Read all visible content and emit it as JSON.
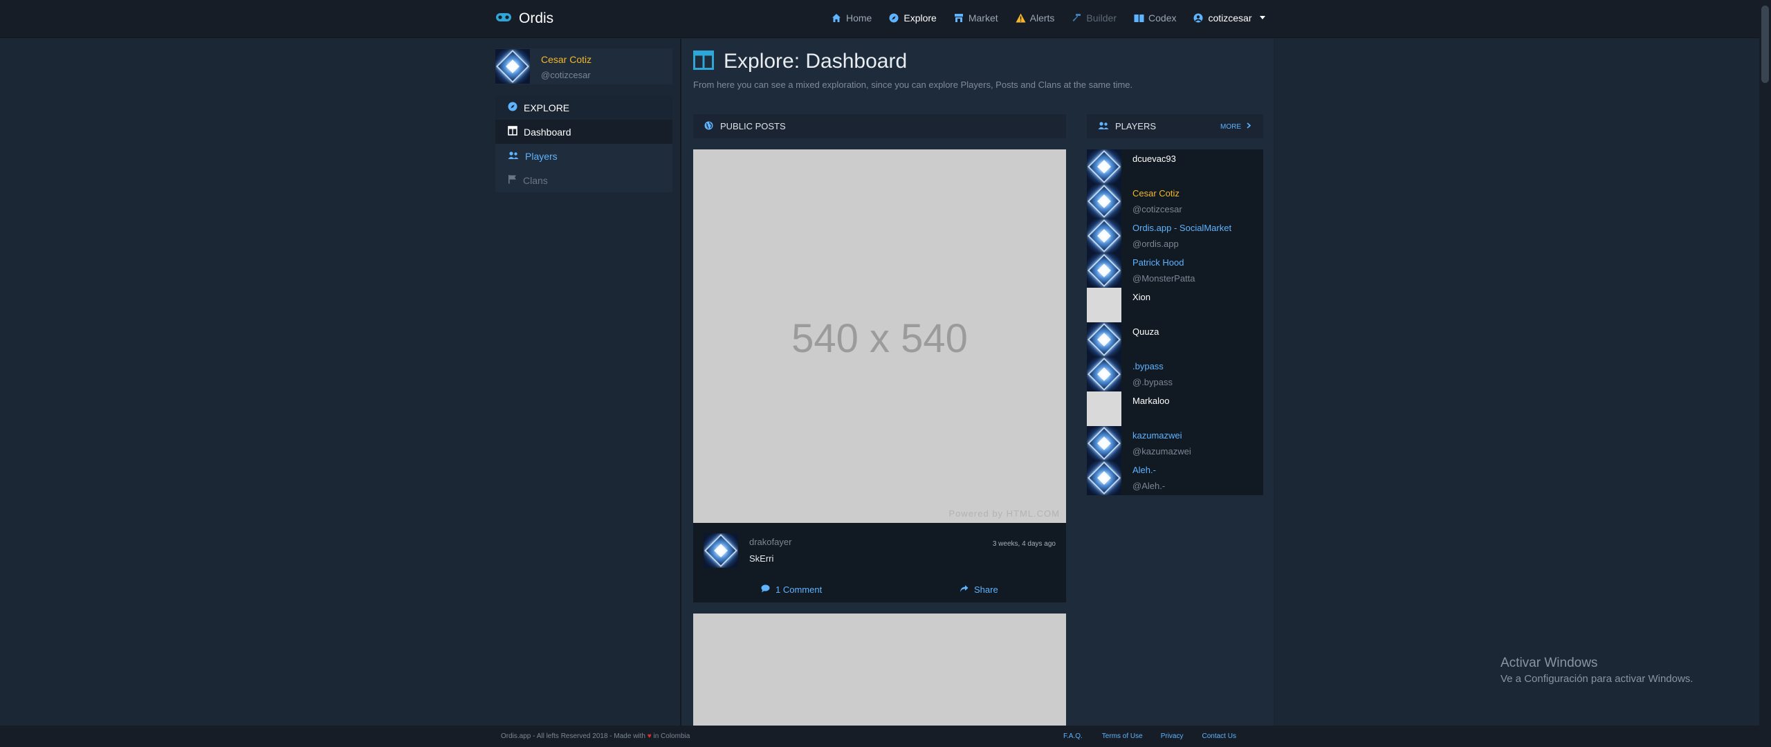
{
  "navbar": {
    "brand": "Ordis",
    "items": [
      {
        "label": "Home",
        "icon": "home-icon",
        "state": "normal"
      },
      {
        "label": "Explore",
        "icon": "compass-icon",
        "state": "active"
      },
      {
        "label": "Market",
        "icon": "market-icon",
        "state": "normal"
      },
      {
        "label": "Alerts",
        "icon": "warning-icon",
        "state": "normal"
      },
      {
        "label": "Builder",
        "icon": "hammer-icon",
        "state": "disabled"
      },
      {
        "label": "Codex",
        "icon": "book-icon",
        "state": "normal"
      }
    ],
    "user": "cotizcesar"
  },
  "profile": {
    "name": "Cesar Cotiz",
    "handle": "@cotizcesar"
  },
  "sidebar": {
    "header": "EXPLORE",
    "items": [
      {
        "label": "Dashboard",
        "icon": "table-icon"
      },
      {
        "label": "Players",
        "icon": "users-icon"
      },
      {
        "label": "Clans",
        "icon": "flag-icon"
      }
    ]
  },
  "page": {
    "title": "Explore: Dashboard",
    "description": "From here you can see a mixed exploration, since you can explore Players, Posts and Clans at the same time."
  },
  "posts": {
    "header": "PUBLIC POSTS",
    "items": [
      {
        "image_text": "540 x 540",
        "image_credit": "Powered by HTML.COM",
        "user": "drakofayer",
        "text": "SkErri",
        "time": "3 weeks, 4 days ago",
        "comments_label": "1 Comment",
        "share_label": "Share"
      }
    ]
  },
  "players": {
    "header": "PLAYERS",
    "more_label": "MORE",
    "items": [
      {
        "name": "dcuevac93",
        "handle": "",
        "name_color": "#ffffff",
        "avatar": "crystal"
      },
      {
        "name": "Cesar Cotiz",
        "handle": "@cotizcesar",
        "name_color": "#f5b728",
        "avatar": "crystal"
      },
      {
        "name": "Ordis.app - SocialMarket",
        "handle": "@ordis.app",
        "name_color": "#5fb4ff",
        "avatar": "crystal"
      },
      {
        "name": "Patrick Hood",
        "handle": "@MonsterPatta",
        "name_color": "#5fb4ff",
        "avatar": "crystal"
      },
      {
        "name": "Xion",
        "handle": "",
        "name_color": "#ffffff",
        "avatar": "placeholder"
      },
      {
        "name": "Quuza",
        "handle": "",
        "name_color": "#ffffff",
        "avatar": "crystal"
      },
      {
        "name": ".bypass",
        "handle": "@.bypass",
        "name_color": "#5fb4ff",
        "avatar": "crystal"
      },
      {
        "name": "Markaloo",
        "handle": "",
        "name_color": "#ffffff",
        "avatar": "placeholder"
      },
      {
        "name": "kazumazwei",
        "handle": "@kazumazwei",
        "name_color": "#5fb4ff",
        "avatar": "crystal"
      },
      {
        "name": "Aleh.-",
        "handle": "@Aleh.-",
        "name_color": "#5fb4ff",
        "avatar": "crystal"
      }
    ]
  },
  "footer": {
    "left_prefix": "Ordis.app - All lefts Reserved 2018 - Made with",
    "left_suffix": "in Colombia",
    "links": [
      "F.A.Q.",
      "Terms of Use",
      "Privacy",
      "Contact Us"
    ]
  },
  "watermark": {
    "title": "Activar Windows",
    "subtitle": "Ve a Configuración para activar Windows."
  },
  "colors": {
    "accent": "#5fb4ff",
    "highlight": "#f5b728",
    "navbar_bg": "#161d26",
    "page_bg": "#1b2735"
  }
}
